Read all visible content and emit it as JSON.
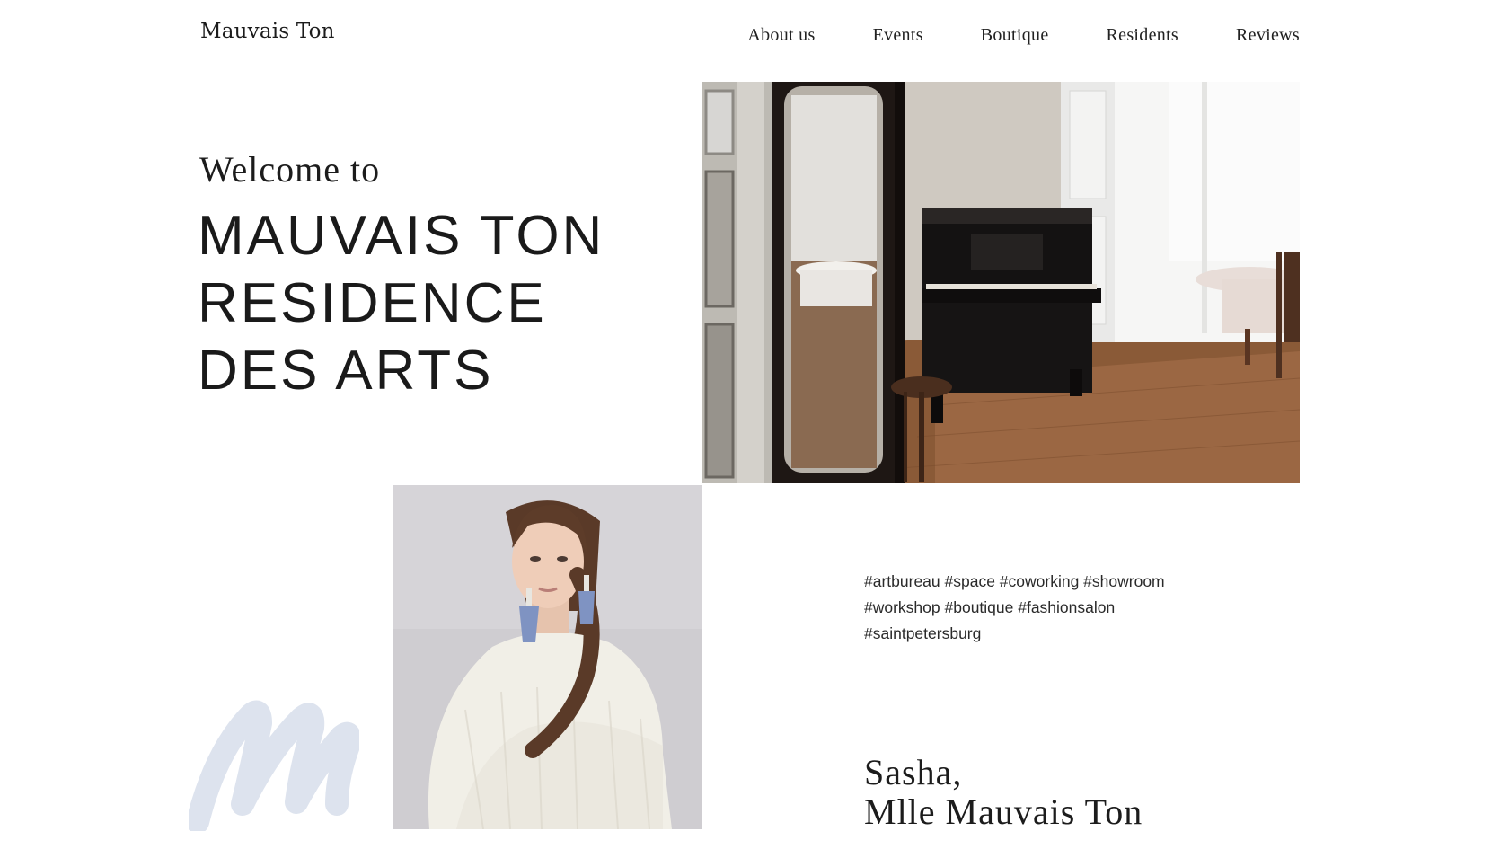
{
  "header": {
    "logo": "Mauvais Ton",
    "nav": [
      "About us",
      "Events",
      "Boutique",
      "Residents",
      "Reviews"
    ]
  },
  "hero": {
    "welcome": "Welcome to",
    "headline": [
      "MAUVAIS TON",
      "RESIDENCE",
      "DES ARTS"
    ]
  },
  "tags": {
    "lines": [
      "#artbureau #space #coworking #showroom",
      "#workshop #boutique #fashionsalon",
      "#saintpetersburg"
    ]
  },
  "signature": {
    "name": "Sasha,",
    "title": "Mlle Mauvais Ton"
  },
  "images": {
    "room": "interior-piano-photo",
    "portrait": "woman-white-sweater-photo",
    "brush": "brush-m-icon"
  },
  "colors": {
    "background": "#ffffff",
    "text": "#1c1c1c",
    "brush": "#dde3ee"
  }
}
